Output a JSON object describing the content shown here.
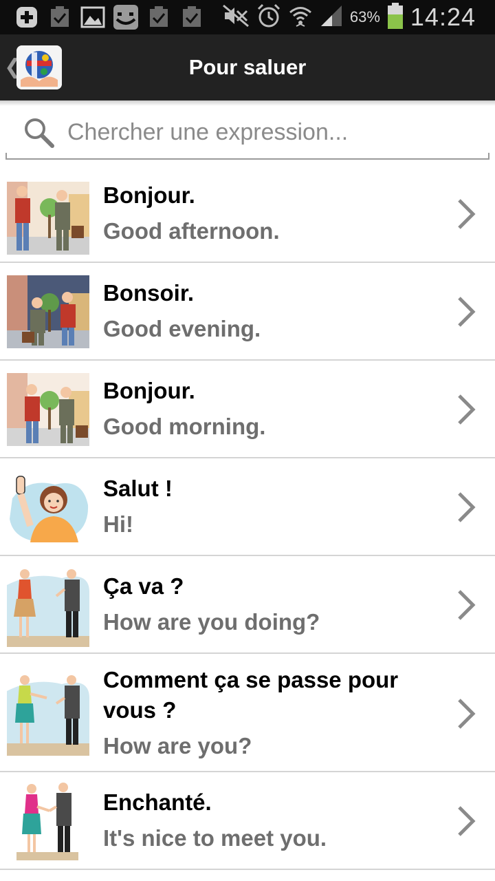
{
  "status_bar": {
    "icons": [
      "add-icon",
      "checkbox-icon",
      "image-icon",
      "messenger-icon",
      "checkbox-icon",
      "checkbox-icon",
      "mute-icon",
      "alarm-icon",
      "wifi-icon",
      "signal-icon",
      "battery-icon"
    ],
    "battery_percent": "63%",
    "battery_level": 0.63,
    "time": "14:24",
    "battery_color": "#8bc34a"
  },
  "action_bar": {
    "title": "Pour saluer",
    "back_icon": "chevron-left-icon",
    "app_icon": "globe-hands-icon"
  },
  "search": {
    "placeholder": "Chercher une expression..."
  },
  "phrases": [
    {
      "french": "Bonjour.",
      "english": "Good afternoon."
    },
    {
      "french": "Bonsoir.",
      "english": "Good evening."
    },
    {
      "french": "Bonjour.",
      "english": "Good morning."
    },
    {
      "french": "Salut !",
      "english": "Hi!"
    },
    {
      "french": "Ça va ?",
      "english": "How are you doing?"
    },
    {
      "french": "Comment ça se passe pour vous ?",
      "english": "How are you?"
    },
    {
      "french": "Enchanté.",
      "english": "It's nice to meet you."
    }
  ],
  "colors": {
    "action_bar": "#222222",
    "status_bar": "#0d0d0d",
    "divider": "#d4d4d4",
    "english_text": "#6e6e6e",
    "chevron": "#8a8a8a"
  }
}
